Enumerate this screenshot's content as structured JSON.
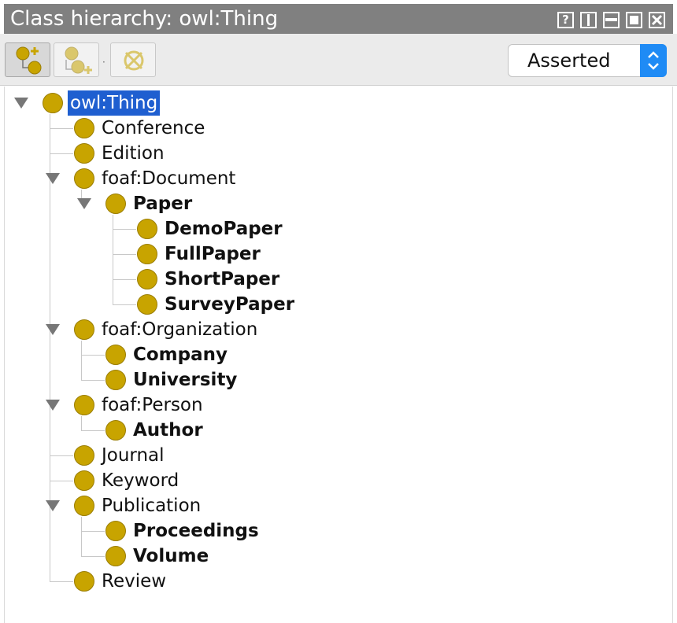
{
  "window": {
    "title": "Class hierarchy: owl:Thing",
    "controls": [
      "help-icon",
      "split-icon",
      "minimize-icon",
      "maximize-icon",
      "close-icon"
    ]
  },
  "toolbar": {
    "buttons": [
      {
        "icon": "add-subclass-icon",
        "pressed": true
      },
      {
        "icon": "add-sibling-icon",
        "pressed": false
      },
      {
        "icon": "delete-class-icon",
        "pressed": false
      }
    ],
    "mode_select": {
      "value": "Asserted"
    }
  },
  "colors": {
    "class_dot": "#c8a400",
    "selection": "#1f5fd0",
    "titlebar": "#808080",
    "stepper": "#1f8bf5"
  },
  "tree": {
    "nodes": [
      {
        "label": "owl:Thing",
        "depth": 0,
        "expanded": true,
        "bold": false,
        "selected": true
      },
      {
        "label": "Conference",
        "depth": 1,
        "bold": false
      },
      {
        "label": "Edition",
        "depth": 1,
        "bold": false
      },
      {
        "label": "foaf:Document",
        "depth": 1,
        "expanded": true,
        "bold": false
      },
      {
        "label": "Paper",
        "depth": 2,
        "expanded": true,
        "bold": true
      },
      {
        "label": "DemoPaper",
        "depth": 3,
        "bold": true
      },
      {
        "label": "FullPaper",
        "depth": 3,
        "bold": true
      },
      {
        "label": "ShortPaper",
        "depth": 3,
        "bold": true
      },
      {
        "label": "SurveyPaper",
        "depth": 3,
        "bold": true
      },
      {
        "label": "foaf:Organization",
        "depth": 1,
        "expanded": true,
        "bold": false
      },
      {
        "label": "Company",
        "depth": 2,
        "bold": true
      },
      {
        "label": "University",
        "depth": 2,
        "bold": true
      },
      {
        "label": "foaf:Person",
        "depth": 1,
        "expanded": true,
        "bold": false
      },
      {
        "label": "Author",
        "depth": 2,
        "bold": true
      },
      {
        "label": "Journal",
        "depth": 1,
        "bold": false
      },
      {
        "label": "Keyword",
        "depth": 1,
        "bold": false
      },
      {
        "label": "Publication",
        "depth": 1,
        "expanded": true,
        "bold": false
      },
      {
        "label": "Proceedings",
        "depth": 2,
        "bold": true
      },
      {
        "label": "Volume",
        "depth": 2,
        "bold": true
      },
      {
        "label": "Review",
        "depth": 1,
        "bold": false
      }
    ]
  }
}
